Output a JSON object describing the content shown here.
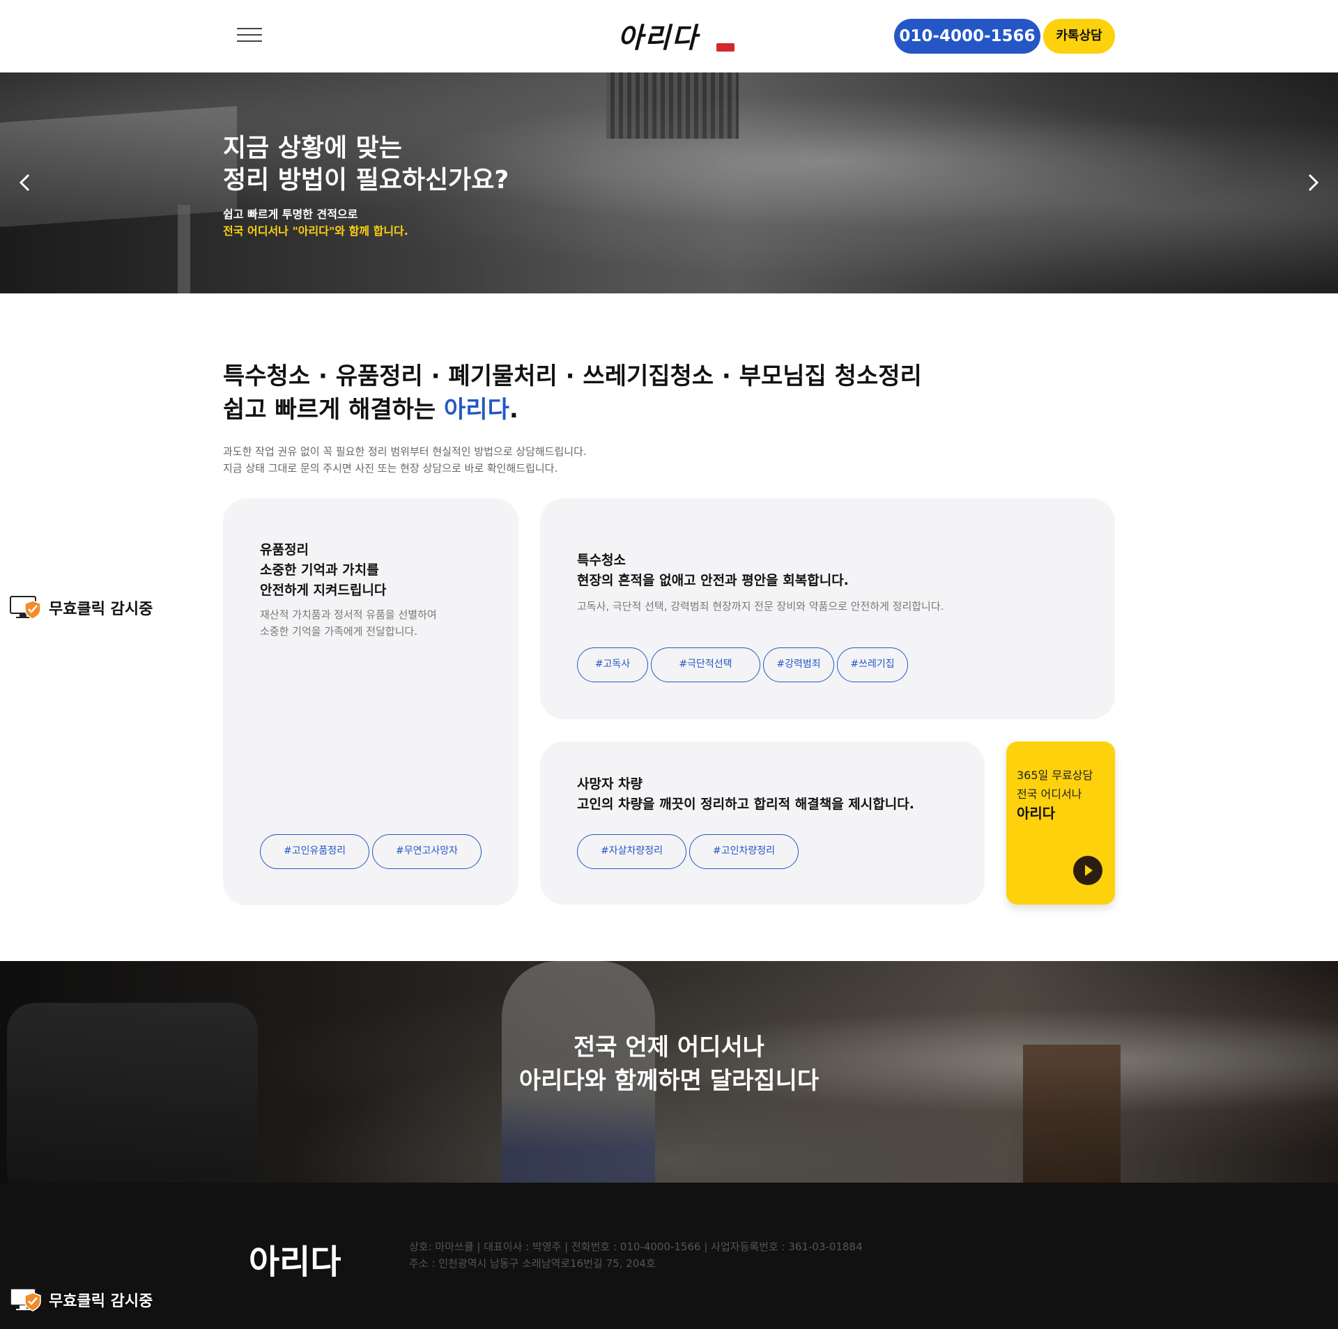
{
  "header": {
    "logo_text": "아리다",
    "phone_label": "010-4000-1566",
    "kakao_label": "카톡상담"
  },
  "hero": {
    "title": "지금 상황에 맞는\n정리 방법이 필요하신가요?",
    "sub1": "쉽고 빠르게 투명한 견적으로",
    "sub2": "전국 어디서나 \"아리다\"와 함께 합니다."
  },
  "services": {
    "heading_line1": "특수청소 · 유품정리 · 폐기물처리 · 쓰레기집청소 · 부모님집 청소정리",
    "heading_line2_pre": "쉽고 빠르게 해결하는 ",
    "heading_line2_accent": "아리다",
    "heading_line2_post": ".",
    "desc_line1": "과도한 작업 권유 없이 꼭 필요한 정리 범위부터 현실적인 방법으로 상담해드립니다.",
    "desc_line2": "지금 상태 그대로 문의 주시면 사진 또는 현장 상담으로 바로 확인해드립니다."
  },
  "cards": {
    "relic": {
      "label": "유품정리",
      "title_l1": "소중한 기억과 가치를",
      "title_l2": "안전하게 지켜드립니다",
      "body_l1": "재산적 가치품과 정서적 유품을 선별하여",
      "body_l2": "소중한 기억을 가족에게 전달합니다.",
      "tags": [
        "#고인유품정리",
        "#무연고사망자"
      ]
    },
    "special": {
      "label": "특수청소",
      "title": "현장의 흔적을 없애고 안전과 평안을 회복합니다.",
      "body": "고독사, 극단적 선택, 강력범죄 현장까지 전문 장비와 약품으로 안전하게 정리합니다.",
      "tags": [
        "#고독사",
        "#극단적선택",
        "#강력범죄",
        "#쓰레기집"
      ]
    },
    "vehicle": {
      "label": "사망자 차량",
      "title": "고인의 차량을 깨끗이 정리하고 합리적 해결책을 제시합니다.",
      "tags": [
        "#자살차량정리",
        "#고인차량정리"
      ]
    },
    "cta": {
      "line1": "365일 무료상담",
      "line2": "전국 어디서나",
      "line3": "아리다"
    }
  },
  "badge": {
    "label": "무효클릭 감시중"
  },
  "banner": {
    "title": "전국 언제 어디서나\n아리다와 함께하면 달라집니다"
  },
  "footer": {
    "logo": "아리다",
    "info_line1": "상호: 마마쓰큘 | 대표이사 : 박영주 | 전화번호 : 010-4000-1566 | 사업자등록번호 : 361-03-01884",
    "info_line2": "주소 : 인천광역시 남동구 소래남역로16번길 75, 204호"
  },
  "colors": {
    "brand_blue": "#2457c5",
    "brand_yellow": "#fdd10c",
    "card_bg": "#f4f4f6",
    "footer_bg": "#111111"
  },
  "icons": [
    "menu-icon",
    "chevron-left-icon",
    "chevron-right-icon",
    "play-icon",
    "monitor-shield-icon"
  ]
}
